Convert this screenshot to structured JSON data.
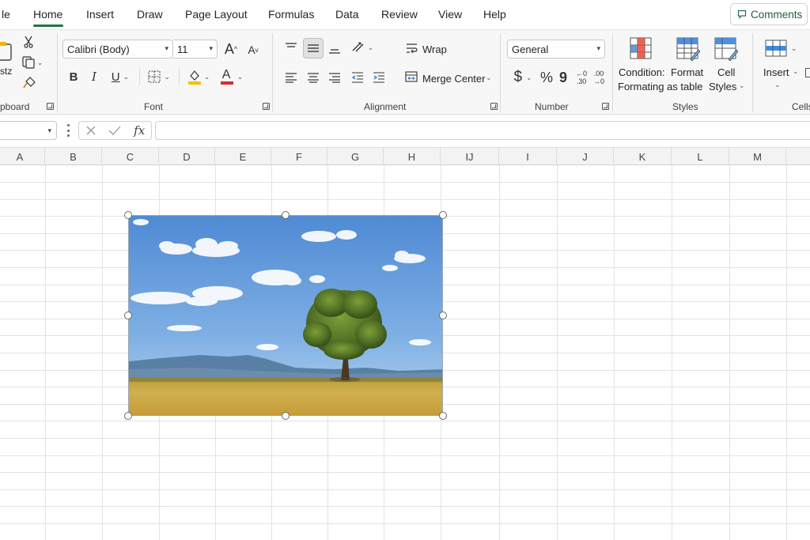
{
  "menu": {
    "tabs": [
      "le",
      "Home",
      "Insert",
      "Draw",
      "Page Layout",
      "Formulas",
      "Data",
      "Review",
      "View",
      "Help"
    ],
    "active_tab": "Home",
    "comments_label": "Comments"
  },
  "ribbon": {
    "clipboard": {
      "paste_fragment": "stz",
      "group_label_fragment": "pboard"
    },
    "font": {
      "font_name": "Calibri (Body)",
      "font_size": "11",
      "grow_label": "A",
      "shrink_label": "A",
      "bold": "B",
      "italic": "I",
      "underline": "U",
      "font_color_letter": "A",
      "group_label": "Font",
      "fill_color": "#f2c200",
      "font_color": "#d32f2f"
    },
    "alignment": {
      "wrap_label": "Wrap",
      "merge_label": "Merge Center",
      "group_label": "Alignment"
    },
    "number": {
      "format": "General",
      "currency": "$",
      "percent": "%",
      "comma": "9",
      "inc_decimal_top": "←0",
      "inc_decimal_bottom": ".30",
      "dec_decimal_top": ".00",
      "dec_decimal_bottom": "→0",
      "group_label": "Number"
    },
    "styles": {
      "conditional_line1": "Condition:",
      "conditional_line2": "Formating",
      "format_line1": "Format",
      "format_line2": "as table",
      "cell_line1": "Cell",
      "cell_line2": "Styles",
      "group_label": "Styles"
    },
    "cells": {
      "insert_label": "Insert",
      "group_label_fragment": "Cells"
    }
  },
  "formula_bar": {
    "name_box": "",
    "fx_label": "fx",
    "formula": ""
  },
  "columns": [
    "A",
    "B",
    "C",
    "D",
    "E",
    "F",
    "G",
    "H",
    "IJ",
    "I",
    "J",
    "K",
    "L",
    "M"
  ],
  "accent_color": "#217346",
  "picture": {
    "subject": "tree-in-meadow",
    "sky_color": "#5b93d6",
    "grass_color": "#c9a94a",
    "tree_color": "#4a6b22"
  }
}
